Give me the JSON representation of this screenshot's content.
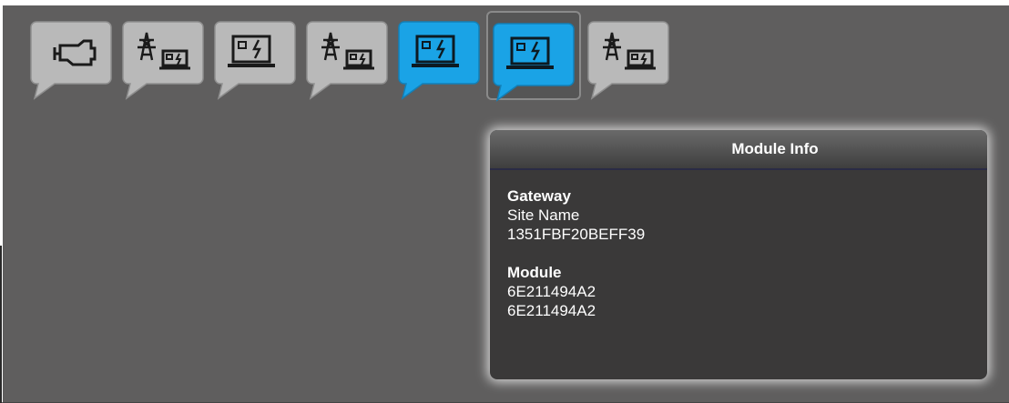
{
  "colors": {
    "background": "#5f5e5e",
    "tile_inactive": "#b9b9b9",
    "tile_active": "#1aa3e6",
    "panel": "#3a3939"
  },
  "toolbar": {
    "tiles": [
      {
        "icon": "engine-icon",
        "active": false
      },
      {
        "icon": "utility-pylon-generator-icon",
        "active": false
      },
      {
        "icon": "generator-icon",
        "active": false
      },
      {
        "icon": "utility-pylon-generator-icon",
        "active": false
      },
      {
        "icon": "generator-icon",
        "active": true
      },
      {
        "icon": "generator-icon",
        "active": true,
        "selected": true
      },
      {
        "icon": "utility-pylon-generator-icon",
        "active": false
      }
    ]
  },
  "module_info": {
    "title": "Module Info",
    "gateway_heading": "Gateway",
    "site_name": "Site Name",
    "gateway_id": "1351FBF20BEFF39",
    "module_heading": "Module",
    "module_id_1": "6E211494A2",
    "module_id_2": "6E211494A2"
  }
}
